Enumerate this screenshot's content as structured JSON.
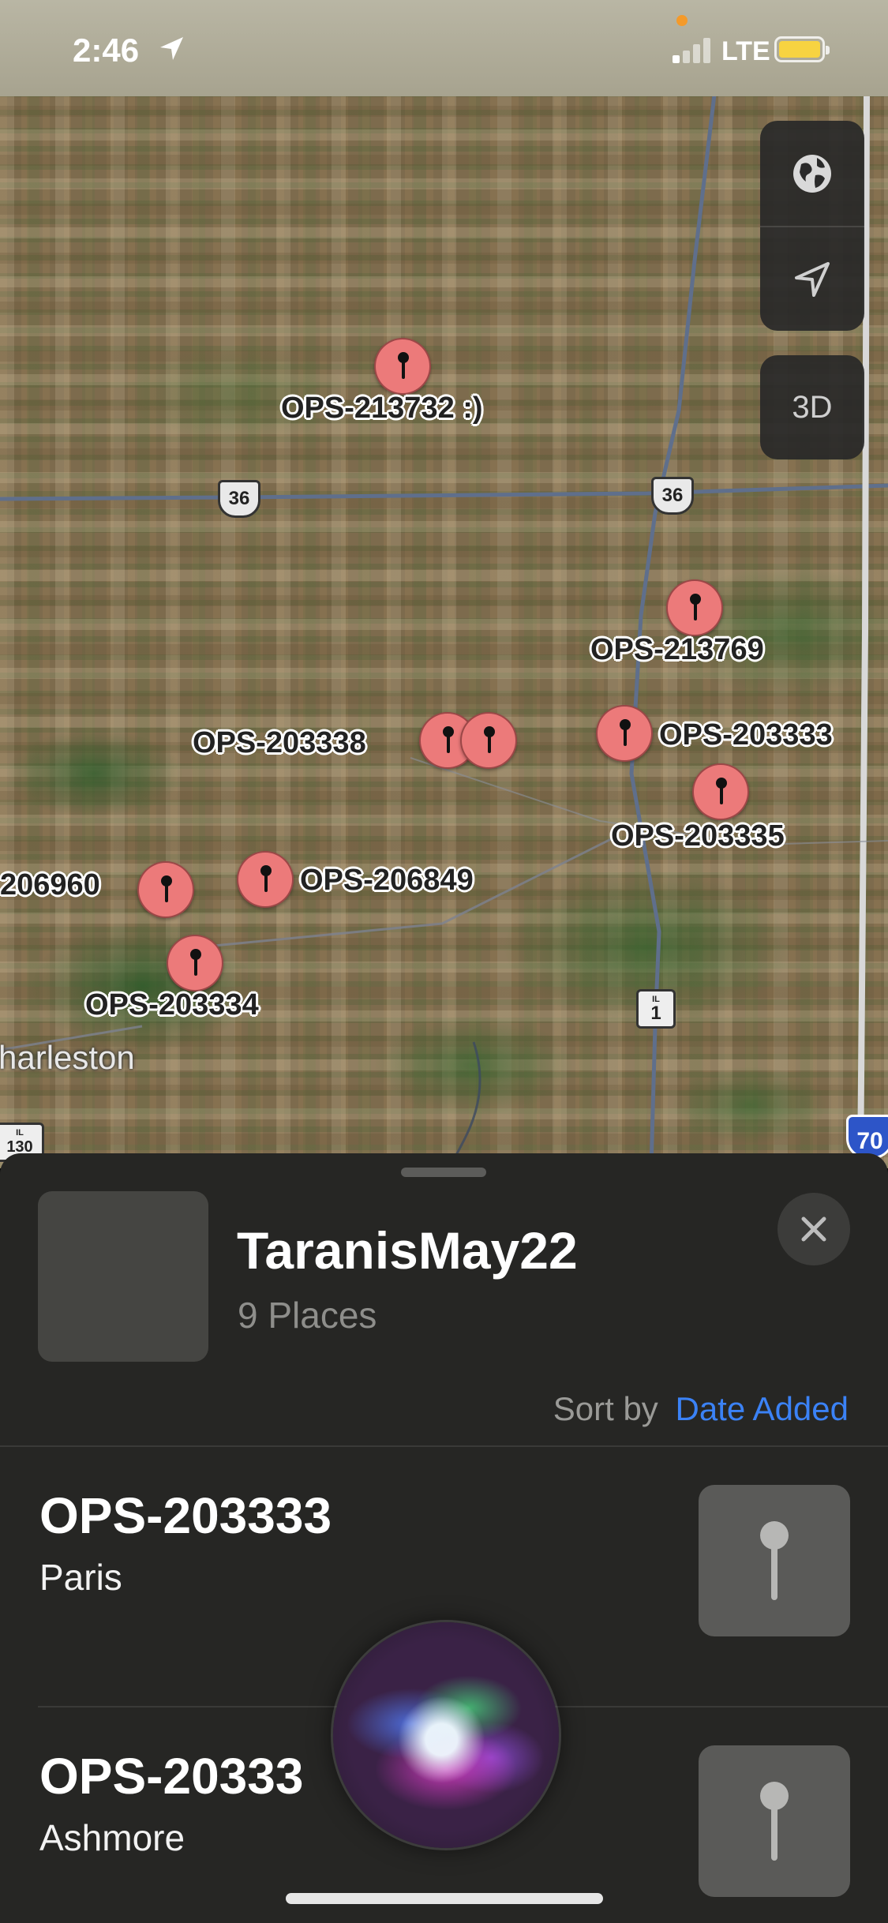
{
  "status_bar": {
    "time": "2:46",
    "network": "LTE",
    "battery_color": "#f7d341"
  },
  "map": {
    "controls": {
      "globe_icon": "globe-icon",
      "location_icon": "location-arrow-icon",
      "three_d_label": "3D"
    },
    "route_shields": [
      {
        "type": "US",
        "number": "36"
      },
      {
        "type": "US",
        "number": "36"
      },
      {
        "type": "IL",
        "state": "IL",
        "number": "1"
      },
      {
        "type": "IL",
        "state": "IL",
        "number": "130"
      },
      {
        "type": "I",
        "number": "70"
      }
    ],
    "city_label": "harleston",
    "pins": [
      {
        "label": "OPS-213732 :)"
      },
      {
        "label": "OPS-213769"
      },
      {
        "label": "OPS-203338"
      },
      {
        "label": "OPS-203333"
      },
      {
        "label": "OPS-203335"
      },
      {
        "label": "206960"
      },
      {
        "label": "OPS-206849"
      },
      {
        "label": "OPS-203334"
      }
    ],
    "pin_color": "#ec7a7a"
  },
  "sheet": {
    "title": "TaranisMay22",
    "subtitle": "9 Places",
    "sort_label": "Sort by",
    "sort_value": "Date Added",
    "accent_color": "#3b82f6",
    "items": [
      {
        "name": "OPS-203333",
        "location": "Paris"
      },
      {
        "name": "OPS-20333",
        "location": "Ashmore"
      }
    ]
  }
}
